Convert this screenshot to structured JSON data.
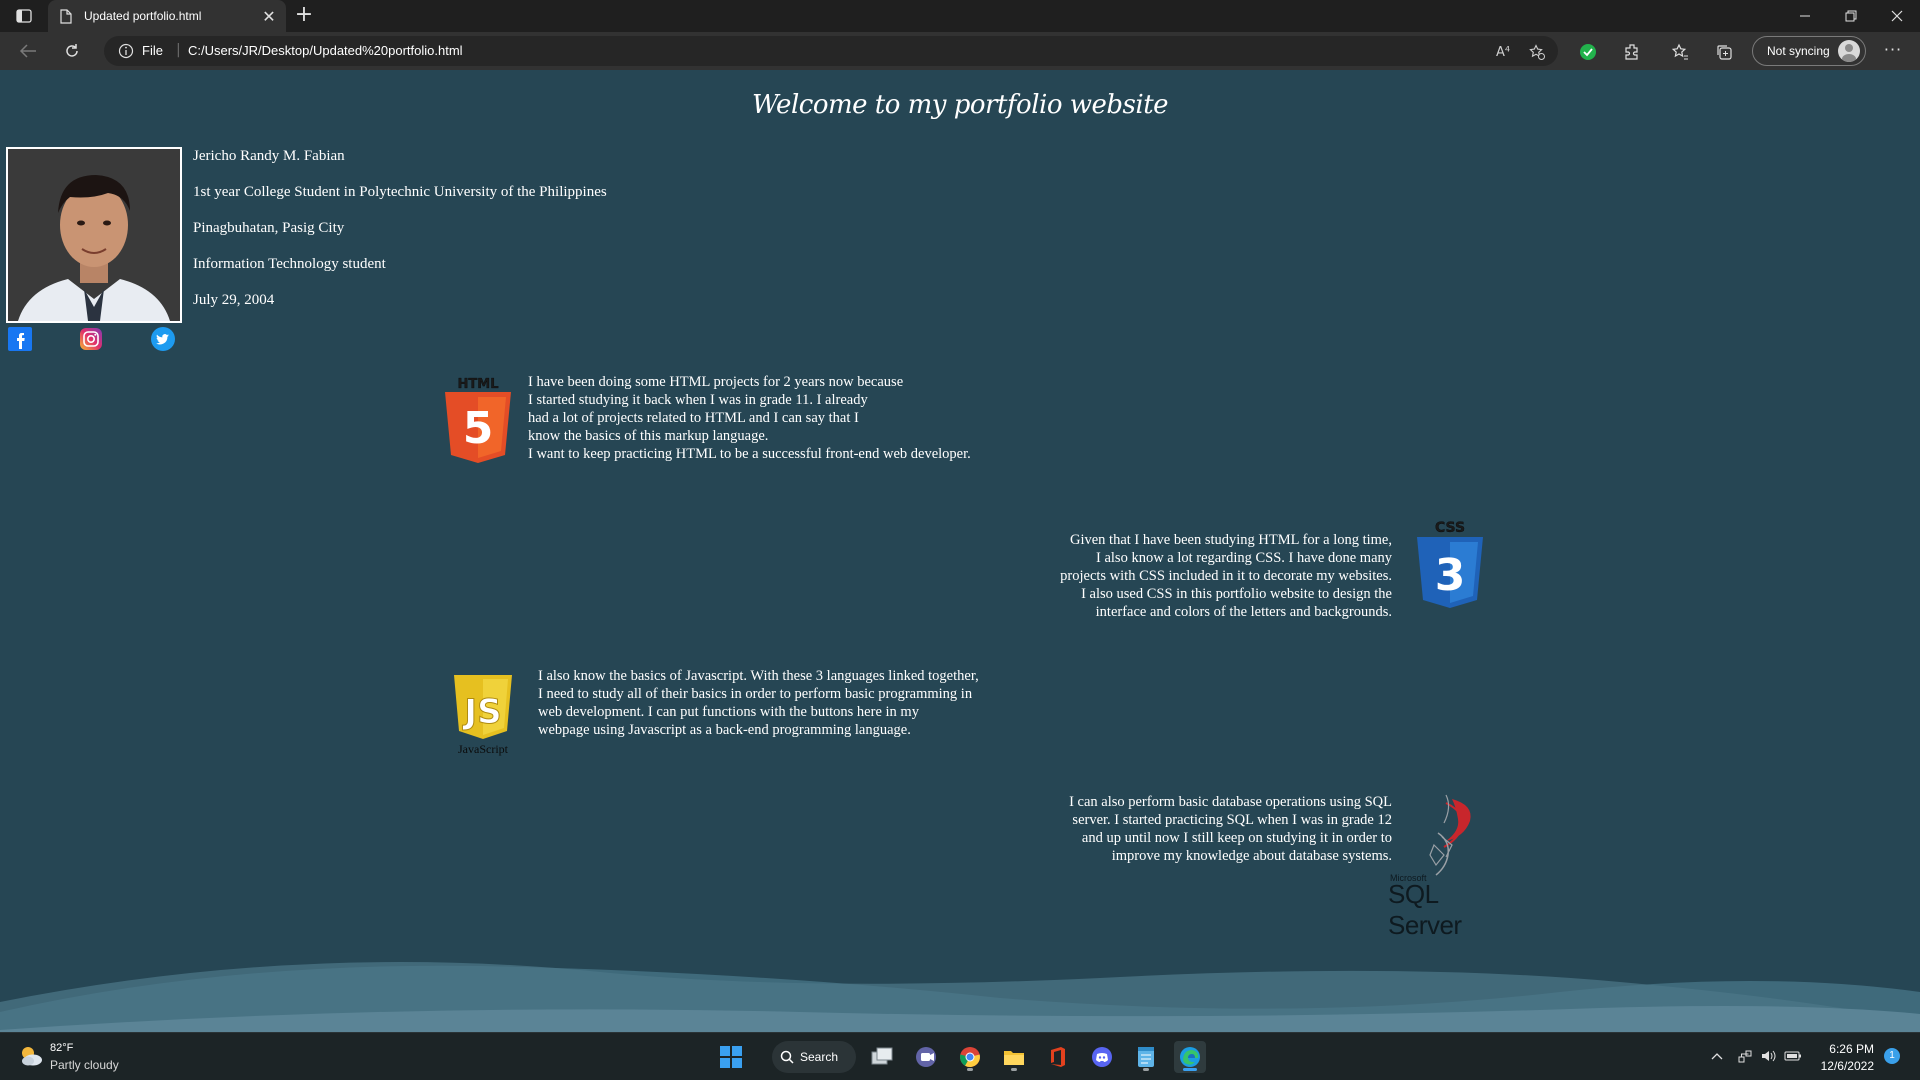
{
  "browser": {
    "tab_title": "Updated portfolio.html",
    "tab_close": "✕",
    "new_tab": "+",
    "address_scheme": "File",
    "address_url": "C:/Users/JR/Desktop/Updated%20portfolio.html",
    "sync_label": "Not syncing",
    "more": "···",
    "read_aloud": "A⁴"
  },
  "page": {
    "title": "Welcome to my portfolio website",
    "profile": {
      "name": "Jericho Randy M. Fabian",
      "school": "1st year College Student in Polytechnic University of the Philippines",
      "address": "Pinagbuhatan, Pasig City",
      "course": "Information Technology student",
      "birthdate": "July 29, 2004"
    },
    "sections": {
      "html": {
        "logo_text": "HTML",
        "logo_number": "5",
        "lines": [
          "I have been doing some HTML projects for 2 years now because",
          "I started studying it back when I was in grade 11. I already",
          "had a lot of projects related to HTML and I can say that I",
          "know the basics of this markup language.",
          "I want to keep practicing HTML to be a successful front-end web developer."
        ]
      },
      "css": {
        "logo_text": "CSS",
        "logo_number": "3",
        "lines": [
          "Given that I have been studying HTML for a long time,",
          "I also know a lot regarding CSS. I have done many",
          "projects with CSS included in it to decorate my websites.",
          "I also used CSS in this portfolio website to design the",
          "interface and colors of the letters and backgrounds."
        ]
      },
      "js": {
        "logo_text": "JS",
        "logo_caption": "JavaScript",
        "lines": [
          "I also know the basics of Javascript. With these 3 languages linked together,",
          "I need to study all of their basics in order to perform basic programming in",
          "web development. I can put functions with the buttons here in my",
          "webpage using Javascript as a back-end programming language."
        ]
      },
      "sql": {
        "logo_small": "Microsoft",
        "logo_text": "SQL Server",
        "lines": [
          "I can also perform basic database operations using SQL",
          "server. I started practicing SQL when I was in grade 12",
          "and up until now I still keep on studying it in order to",
          "improve my knowledge about database systems."
        ]
      }
    }
  },
  "taskbar": {
    "weather_temp": "82°F",
    "weather_desc": "Partly cloudy",
    "search_label": "Search",
    "time": "6:26 PM",
    "date": "12/6/2022",
    "notification_count": "1"
  },
  "colors": {
    "page_background": "#264654",
    "wave_light": "#5b8496",
    "wave_mid": "#3f6a7b",
    "html_orange": "#e44d26",
    "css_blue": "#1f62b8",
    "js_yellow": "#e6c020",
    "sql_red": "#c8262c"
  }
}
